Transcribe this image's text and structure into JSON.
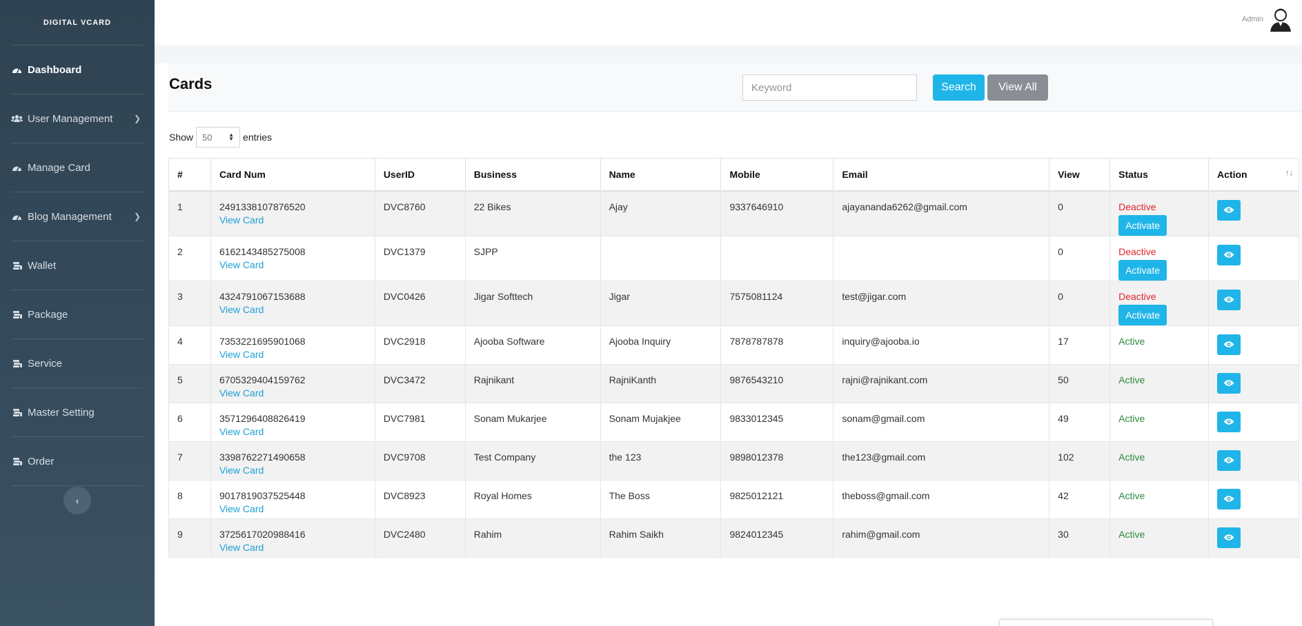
{
  "brand": "DIGITAL VCARD",
  "sidebar": {
    "items": [
      {
        "label": "Dashboard",
        "icon": "dashboard-icon",
        "active": true,
        "has_submenu": false
      },
      {
        "label": "User Management",
        "icon": "users-icon",
        "active": false,
        "has_submenu": true
      },
      {
        "label": "Manage Card",
        "icon": "dashboard-icon",
        "active": false,
        "has_submenu": false
      },
      {
        "label": "Blog Management",
        "icon": "dashboard-icon",
        "active": false,
        "has_submenu": true
      },
      {
        "label": "Wallet",
        "icon": "coins-icon",
        "active": false,
        "has_submenu": false
      },
      {
        "label": "Package",
        "icon": "coins-icon",
        "active": false,
        "has_submenu": false
      },
      {
        "label": "Service",
        "icon": "coins-icon",
        "active": false,
        "has_submenu": false
      },
      {
        "label": "Master Setting",
        "icon": "coins-icon",
        "active": false,
        "has_submenu": false
      },
      {
        "label": "Order",
        "icon": "coins-icon",
        "active": false,
        "has_submenu": false
      }
    ],
    "collapse_icon": "chevron-left-icon"
  },
  "topbar": {
    "user_label": "Admin"
  },
  "page": {
    "title": "Cards",
    "search_placeholder": "Keyword",
    "search_button": "Search",
    "view_all_button": "View All",
    "show_label": "Show",
    "entries_value": "50",
    "entries_label": "entries"
  },
  "table": {
    "columns": [
      "#",
      "Card Num",
      "UserID",
      "Business",
      "Name",
      "Mobile",
      "Email",
      "View",
      "Status",
      "Action"
    ],
    "view_card_label": "View Card",
    "activate_label": "Activate",
    "rows": [
      {
        "num": "1",
        "card": "2491338107876520",
        "userid": "DVC8760",
        "business": "22 Bikes",
        "name": "Ajay",
        "mobile": "9337646910",
        "email": "ajayananda6262@gmail.com",
        "view": "0",
        "status": "Deactive"
      },
      {
        "num": "2",
        "card": "6162143485275008",
        "userid": "DVC1379",
        "business": "SJPP",
        "name": "",
        "mobile": "",
        "email": "",
        "view": "0",
        "status": "Deactive"
      },
      {
        "num": "3",
        "card": "4324791067153688",
        "userid": "DVC0426",
        "business": "Jigar Softtech",
        "name": "Jigar",
        "mobile": "7575081124",
        "email": "test@jigar.com",
        "view": "0",
        "status": "Deactive"
      },
      {
        "num": "4",
        "card": "7353221695901068",
        "userid": "DVC2918",
        "business": "Ajooba Software",
        "name": "Ajooba Inquiry",
        "mobile": "7878787878",
        "email": "inquiry@ajooba.io",
        "view": "17",
        "status": "Active"
      },
      {
        "num": "5",
        "card": "6705329404159762",
        "userid": "DVC3472",
        "business": "Rajnikant",
        "name": "RajniKanth",
        "mobile": "9876543210",
        "email": "rajni@rajnikant.com",
        "view": "50",
        "status": "Active"
      },
      {
        "num": "6",
        "card": "3571296408826419",
        "userid": "DVC7981",
        "business": "Sonam Mukarjee",
        "name": "Sonam Mujakjee",
        "mobile": "9833012345",
        "email": "sonam@gmail.com",
        "view": "49",
        "status": "Active"
      },
      {
        "num": "7",
        "card": "3398762271490658",
        "userid": "DVC9708",
        "business": "Test Company",
        "name": "the 123",
        "mobile": "9898012378",
        "email": "the123@gmail.com",
        "view": "102",
        "status": "Active"
      },
      {
        "num": "8",
        "card": "9017819037525448",
        "userid": "DVC8923",
        "business": "Royal Homes",
        "name": "The Boss",
        "mobile": "9825012121",
        "email": "theboss@gmail.com",
        "view": "42",
        "status": "Active"
      },
      {
        "num": "9",
        "card": "3725617020988416",
        "userid": "DVC2480",
        "business": "Rahim",
        "name": "Rahim Saikh",
        "mobile": "9824012345",
        "email": "rahim@gmail.com",
        "view": "30",
        "status": "Active"
      }
    ]
  },
  "colors": {
    "accent": "#1fb5e8",
    "deactive": "#e2242b",
    "active": "#2b8a3e",
    "sidebar": "#34495a"
  }
}
